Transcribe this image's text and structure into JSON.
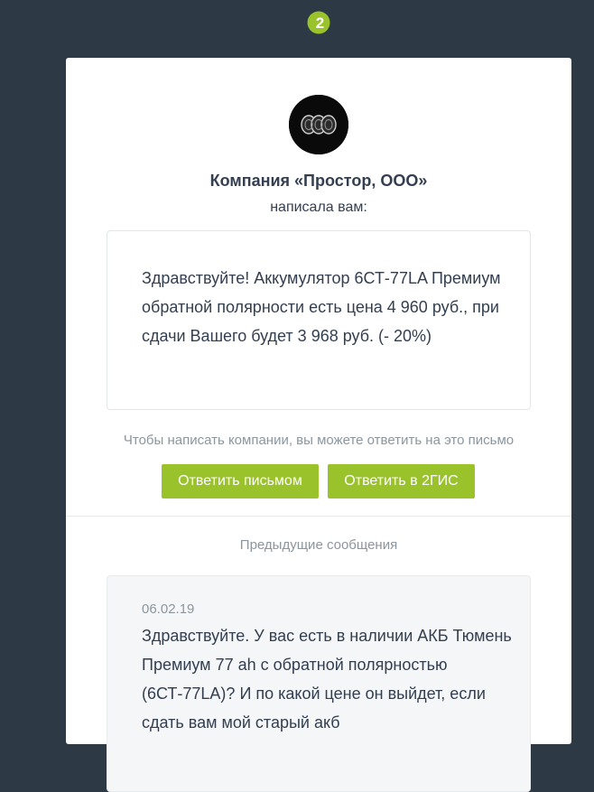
{
  "brand": {
    "logo_text": "2",
    "accent": "#9ac22b",
    "background": "#2d3a45"
  },
  "header": {
    "company_name": "Компания «Простор, ООО»",
    "wrote_label": "написала вам:"
  },
  "message": {
    "text": "Здравствуйте! Аккумулятор 6СТ-77LA Премиум обратной полярности есть цена 4 960 руб., при сдачи Вашего будет 3 968 руб. (- 20%)"
  },
  "reply": {
    "hint": "Чтобы написать компании, вы можете ответить на это письмо",
    "reply_email_label": "Ответить письмом",
    "reply_2gis_label": "Ответить в 2ГИС"
  },
  "previous": {
    "title": "Предыдущие сообщения",
    "items": [
      {
        "date": "06.02.19",
        "text": "Здравствуйте. У вас есть в наличии АКБ Тюмень Премиум 77 ah с обратной полярностью (6СТ-77LA)? И по какой цене он выйдет, если сдать вам мой старый акб"
      }
    ]
  }
}
